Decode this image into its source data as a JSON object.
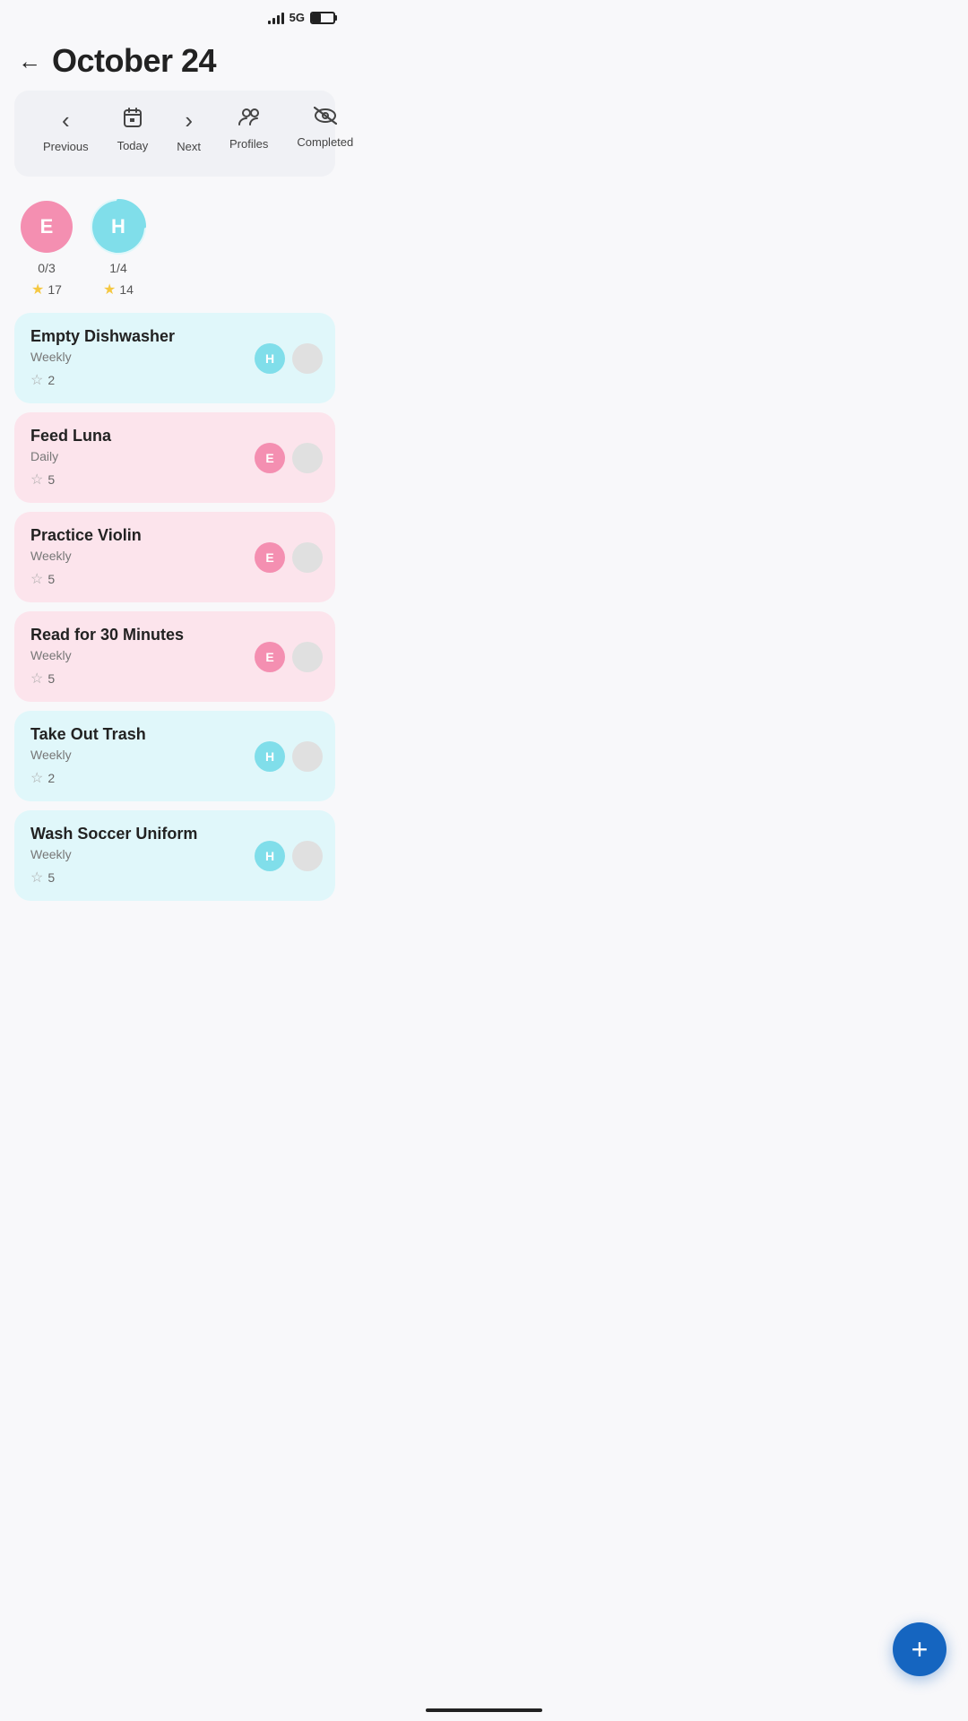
{
  "statusBar": {
    "network": "5G"
  },
  "header": {
    "backLabel": "←",
    "title": "October 24"
  },
  "toolbar": {
    "items": [
      {
        "id": "previous",
        "icon": "‹",
        "label": "Previous"
      },
      {
        "id": "today",
        "icon": "📅",
        "label": "Today"
      },
      {
        "id": "next",
        "icon": "›",
        "label": "Next"
      },
      {
        "id": "profiles",
        "icon": "👥",
        "label": "Profiles"
      },
      {
        "id": "completed",
        "icon": "👁‍🗨",
        "label": "Completed"
      }
    ]
  },
  "profiles": [
    {
      "id": "E",
      "initial": "E",
      "color": "pink",
      "score": "0/3",
      "stars": 17,
      "hasRing": false
    },
    {
      "id": "H",
      "initial": "H",
      "color": "blue",
      "score": "1/4",
      "stars": 14,
      "hasRing": true
    }
  ],
  "tasks": [
    {
      "id": "task-1",
      "title": "Empty Dishwasher",
      "frequency": "Weekly",
      "points": 2,
      "assignee": "H",
      "assigneeColor": "blue"
    },
    {
      "id": "task-2",
      "title": "Feed Luna",
      "frequency": "Daily",
      "points": 5,
      "assignee": "E",
      "assigneeColor": "pink"
    },
    {
      "id": "task-3",
      "title": "Practice Violin",
      "frequency": "Weekly",
      "points": 5,
      "assignee": "E",
      "assigneeColor": "pink"
    },
    {
      "id": "task-4",
      "title": "Read for 30 Minutes",
      "frequency": "Weekly",
      "points": 5,
      "assignee": "E",
      "assigneeColor": "pink"
    },
    {
      "id": "task-5",
      "title": "Take Out Trash",
      "frequency": "Weekly",
      "points": 2,
      "assignee": "H",
      "assigneeColor": "blue"
    },
    {
      "id": "task-6",
      "title": "Wash Soccer Uniform",
      "frequency": "Weekly",
      "points": 5,
      "assignee": "H",
      "assigneeColor": "blue"
    }
  ],
  "fab": {
    "label": "+"
  }
}
